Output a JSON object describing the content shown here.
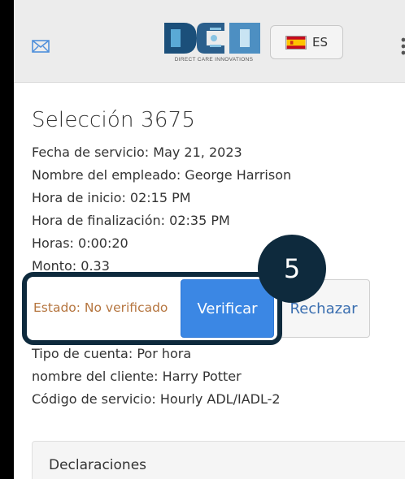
{
  "header": {
    "logo_text": "DCI",
    "logo_tagline": "DIRECT CARE INNOVATIONS",
    "language": {
      "label": "ES",
      "flag_icon": "spain-flag-icon"
    },
    "mail_icon": "envelope-icon",
    "menu_icon": "vertical-dots-icon"
  },
  "selection": {
    "title": "Selección 3675",
    "service_date": "Fecha de servicio: May 21, 2023",
    "employee_name": "Nombre del empleado: George Harrison",
    "start_time": "Hora de inicio: 02:15 PM",
    "end_time": "Hora de finalización: 02:35 PM",
    "hours": "Horas: 0:00:20",
    "amount": "Monto: 0.33"
  },
  "status": {
    "label": "Estado: No verificado",
    "verify_label": "Verificar",
    "reject_label": "Rechazar"
  },
  "details": {
    "account_type": "Tipo de cuenta: Por hora",
    "client_name": "nombre del cliente: Harry Potter",
    "service_code": "Código de servicio: Hourly ADL/IADL-2"
  },
  "declarations_label": "Declaraciones",
  "step_badge": "5",
  "colors": {
    "header_bg": "#ececec",
    "accent": "#3b87e4",
    "status_text": "#b5753f",
    "highlight": "#0e2a3d"
  }
}
